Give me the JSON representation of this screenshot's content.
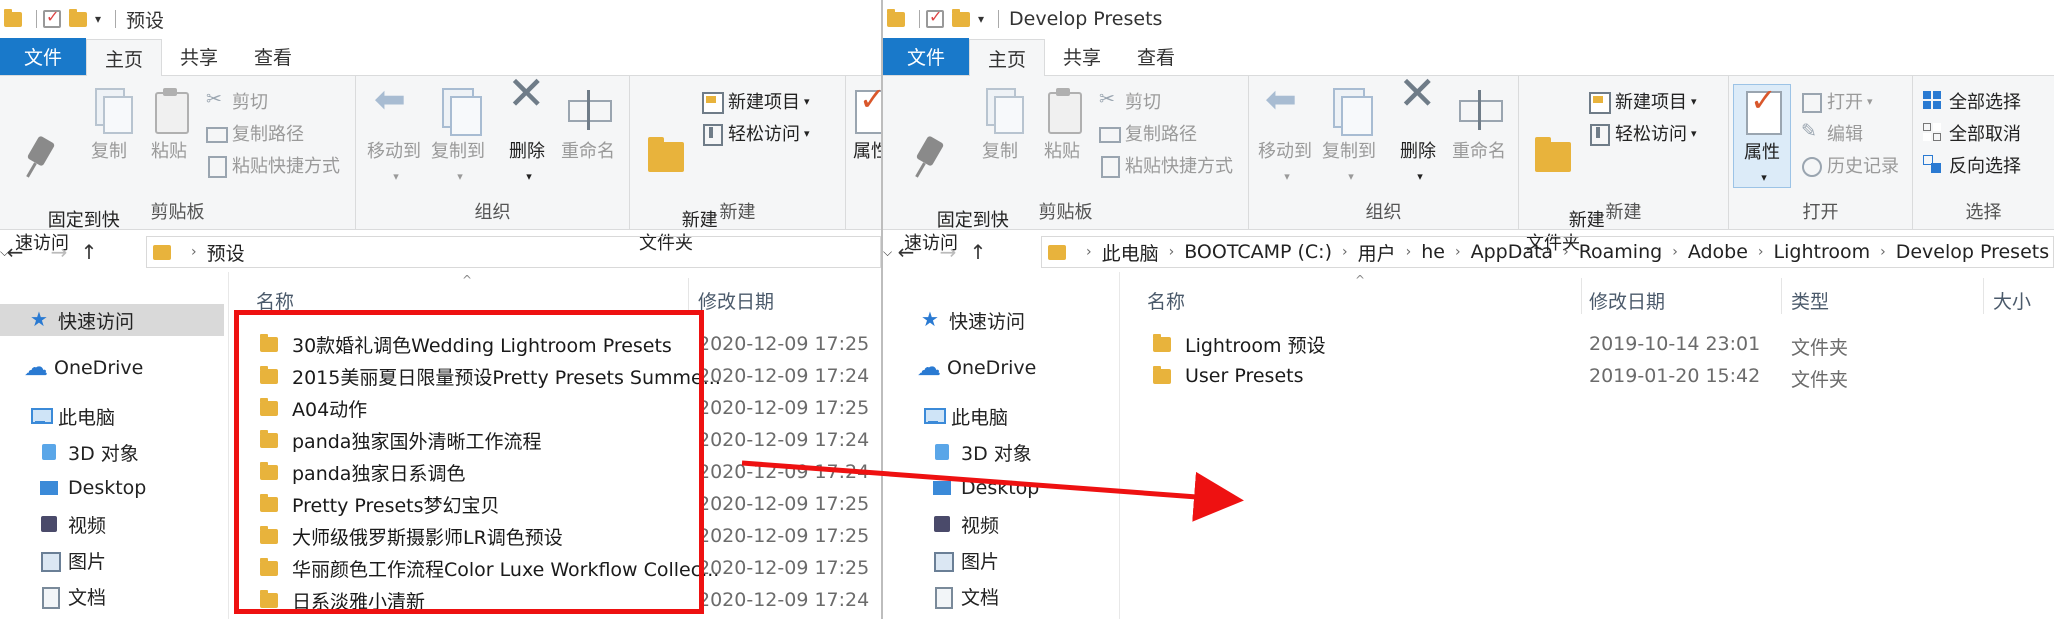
{
  "left": {
    "title": "预设",
    "tabs": {
      "file": "文件",
      "home": "主页",
      "share": "共享",
      "view": "查看"
    },
    "ribbon": {
      "pin": "固定到快\n速访问",
      "copy": "复制",
      "paste": "粘贴",
      "cut": "剪切",
      "copy_path": "复制路径",
      "paste_shortcut": "粘贴快捷方式",
      "clipboard_label": "剪贴板",
      "move_to": "移动到",
      "copy_to": "复制到",
      "delete": "删除",
      "rename": "重命名",
      "organize_label": "组织",
      "new_folder": "新建\n文件夹",
      "new_item": "新建项目",
      "easy_access": "轻松访问",
      "new_label": "新建",
      "properties": "属性"
    },
    "address": [
      "预设"
    ],
    "nav": {
      "quick_access": "快速访问",
      "onedrive": "OneDrive",
      "this_pc": "此电脑",
      "objects3d": "3D 对象",
      "desktop": "Desktop",
      "videos": "视频",
      "pictures": "图片",
      "documents": "文档"
    },
    "columns": {
      "name": "名称",
      "date": "修改日期"
    },
    "files": [
      {
        "name": "30款婚礼调色Wedding Lightroom Presets",
        "date": "2020-12-09 17:25"
      },
      {
        "name": "2015美丽夏日限量预设Pretty Presets Summe...",
        "date": "2020-12-09 17:24"
      },
      {
        "name": "A04动作",
        "date": "2020-12-09 17:25"
      },
      {
        "name": "panda独家国外清晰工作流程",
        "date": "2020-12-09 17:24"
      },
      {
        "name": "panda独家日系调色",
        "date": "2020-12-09 17:24"
      },
      {
        "name": "Pretty Presets梦幻宝贝",
        "date": "2020-12-09 17:25"
      },
      {
        "name": "大师级俄罗斯摄影师LR调色预设",
        "date": "2020-12-09 17:25"
      },
      {
        "name": "华丽颜色工作流程Color Luxe Workflow Collec...",
        "date": "2020-12-09 17:25"
      },
      {
        "name": "日系淡雅小清新",
        "date": "2020-12-09 17:24"
      }
    ]
  },
  "right": {
    "title": "Develop Presets",
    "tabs": {
      "file": "文件",
      "home": "主页",
      "share": "共享",
      "view": "查看"
    },
    "ribbon": {
      "pin": "固定到快\n速访问",
      "copy": "复制",
      "paste": "粘贴",
      "cut": "剪切",
      "copy_path": "复制路径",
      "paste_shortcut": "粘贴快捷方式",
      "clipboard_label": "剪贴板",
      "move_to": "移动到",
      "copy_to": "复制到",
      "delete": "删除",
      "rename": "重命名",
      "organize_label": "组织",
      "new_folder": "新建\n文件夹",
      "new_item": "新建项目",
      "easy_access": "轻松访问",
      "new_label": "新建",
      "properties": "属性",
      "open": "打开",
      "edit": "编辑",
      "history": "历史记录",
      "open_label": "打开",
      "select_all": "全部选择",
      "select_none": "全部取消",
      "invert": "反向选择",
      "select_label": "选择"
    },
    "address": [
      "此电脑",
      "BOOTCAMP (C:)",
      "用户",
      "he",
      "AppData",
      "Roaming",
      "Adobe",
      "Lightroom",
      "Develop Presets"
    ],
    "nav": {
      "quick_access": "快速访问",
      "onedrive": "OneDrive",
      "this_pc": "此电脑",
      "objects3d": "3D 对象",
      "desktop": "Desktop",
      "videos": "视频",
      "pictures": "图片",
      "documents": "文档"
    },
    "columns": {
      "name": "名称",
      "date": "修改日期",
      "type": "类型",
      "size": "大小"
    },
    "files": [
      {
        "name": "Lightroom 预设",
        "date": "2019-10-14 23:01",
        "type": "文件夹"
      },
      {
        "name": "User Presets",
        "date": "2019-01-20 15:42",
        "type": "文件夹"
      }
    ]
  },
  "colors": {
    "accent": "#1979ca",
    "folder": "#e8b33c",
    "annotation": "#ee1111"
  }
}
